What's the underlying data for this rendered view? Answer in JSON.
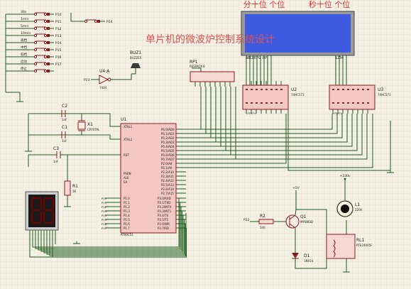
{
  "title": "单片机的微波炉控制系统设计",
  "lcd": {
    "label_minute": "分十位 个位",
    "label_second": "秒十位 个位",
    "pins_left": "ABCDEFG DP",
    "pins_right": "1234"
  },
  "components": {
    "buz1": {
      "ref": "BUZ1",
      "value": "BUZZER"
    },
    "u4a": {
      "ref": "U4:A",
      "value": "7404"
    },
    "rp1": {
      "ref": "RP1",
      "value": "RESPACK-8"
    },
    "u2": {
      "ref": "U2",
      "value": "74HC573"
    },
    "u3": {
      "ref": "U3",
      "value": "74HC573"
    },
    "u1": {
      "ref": "U1",
      "value": "AT89C51"
    },
    "c2": {
      "ref": "C2",
      "value": "1nF"
    },
    "c1": {
      "ref": "C1",
      "value": "1nF"
    },
    "c3": {
      "ref": "C3",
      "value": "1nF"
    },
    "x1": {
      "ref": "X1",
      "value": "CRYSTAL"
    },
    "r1": {
      "ref": "R1",
      "value": "1K"
    },
    "r2": {
      "ref": "R2",
      "value": "500"
    },
    "q1": {
      "ref": "Q1",
      "value": "MPS8682"
    },
    "d1": {
      "ref": "D1",
      "value": "1N914"
    },
    "l1": {
      "ref": "L1",
      "value": "220V"
    },
    "rl1": {
      "ref": "RL1",
      "value": "RTE24005F"
    }
  },
  "text_placeholder": "<TEXT>",
  "nets": {
    "p10": "P10",
    "p11": "P11",
    "p12": "P12",
    "p13": "P13",
    "p14": "P14",
    "p15": "P15",
    "p16": "P16",
    "p17": "P17",
    "p23": "P23",
    "p24": "P24",
    "p22": "P22"
  },
  "keys": [
    "30s",
    "1min",
    "5min",
    "10min",
    "高档",
    "中档",
    "低档",
    "启动",
    "停止"
  ],
  "supplies": {
    "plus5v": "+5V",
    "plus220v": "+220v"
  },
  "u1_left_pins": [
    "XTAL1",
    "XTAL2",
    "RST",
    "PSEN",
    "ALE",
    "EA"
  ],
  "u1_port0": [
    "P0.0/AD0",
    "P0.1/AD1",
    "P0.2/AD2",
    "P0.3/AD3",
    "P0.4/AD4",
    "P0.5/AD5",
    "P0.6/AD6",
    "P0.7/AD7"
  ],
  "u1_port2": [
    "P2.0/A8",
    "P2.1/A9",
    "P2.2/A10",
    "P2.3/A11",
    "P2.4/A12",
    "P2.5/A13",
    "P2.6/A14",
    "P2.7/A15"
  ],
  "u1_port1": [
    "P1.0",
    "P1.1",
    "P1.2",
    "P1.3",
    "P1.4",
    "P1.5",
    "P1.6",
    "P1.7"
  ],
  "u1_port3": [
    "P3.0/RXD",
    "P3.1/TXD",
    "P3.2/INT0",
    "P3.3/INT1",
    "P3.4/T0",
    "P3.5/T1",
    "P3.6/WR",
    "P3.7/RD"
  ],
  "colors": {
    "background": "#f4f1e4",
    "grid": "#d7d2bf",
    "wire": "#1c5a1c",
    "component": "#8b1a1a",
    "chip_fill": "#f2c8c0",
    "lcd_fill": "#3d5be0",
    "title": "#e05050",
    "lcd_label": "#e03030"
  }
}
